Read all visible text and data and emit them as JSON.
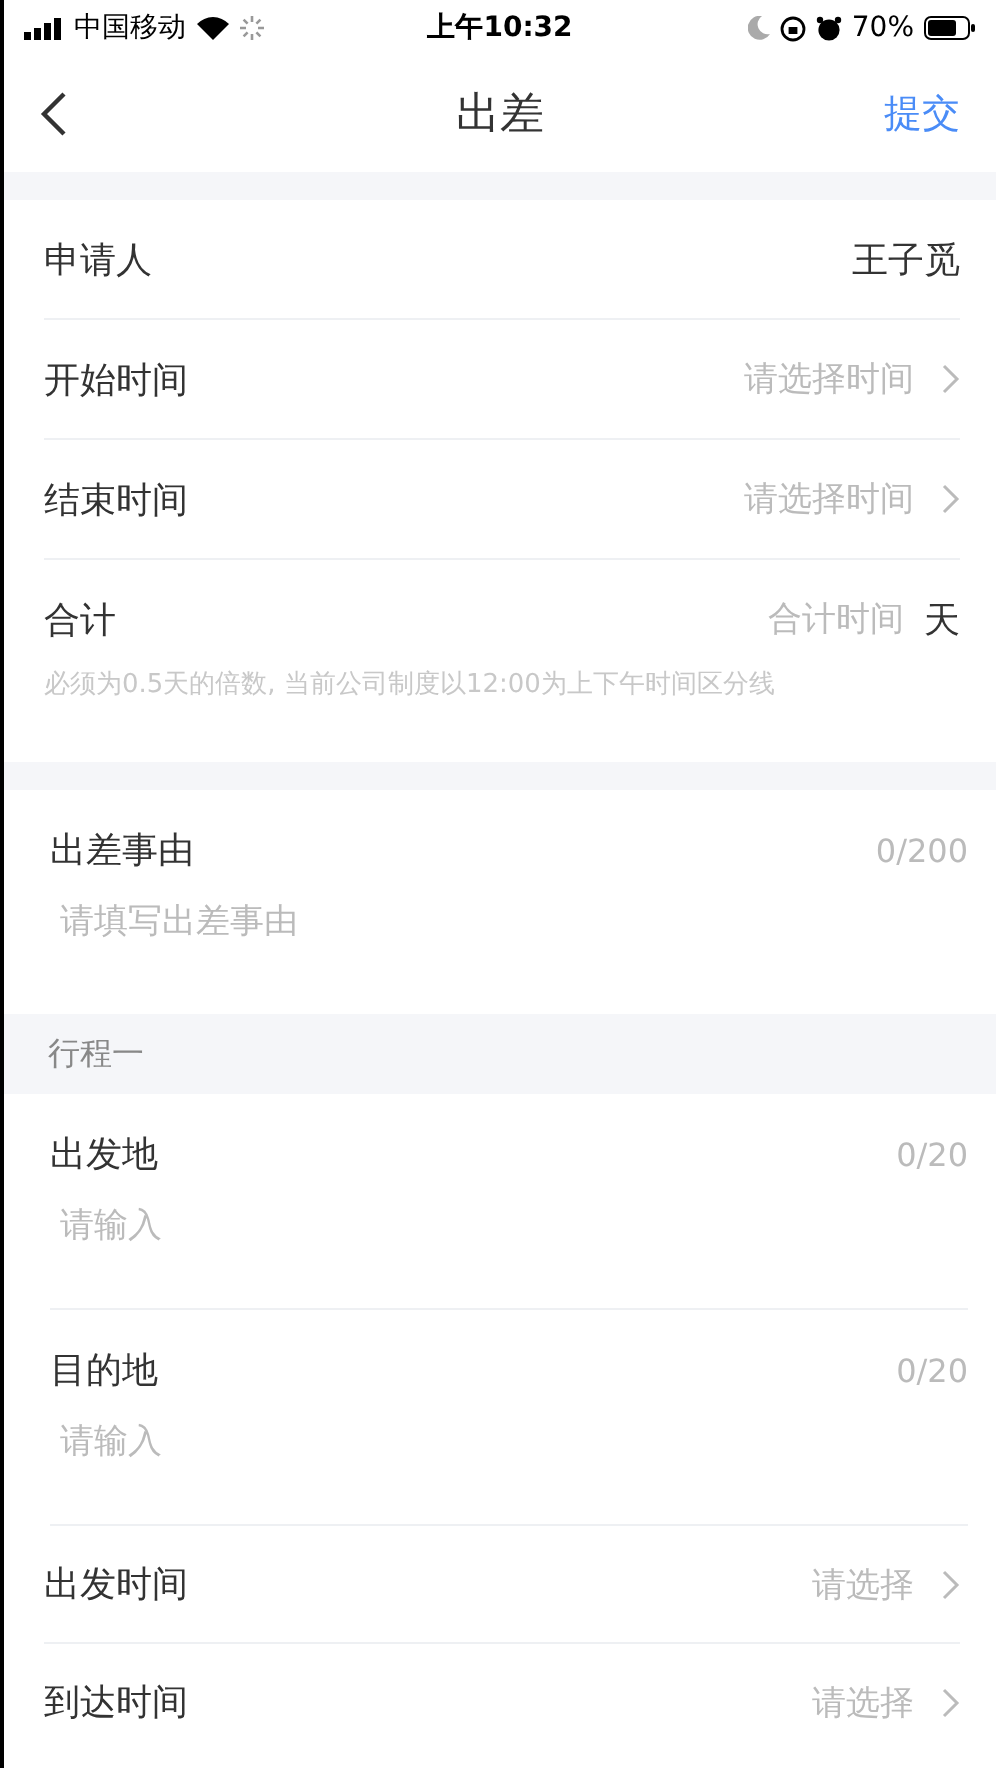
{
  "status_bar": {
    "carrier": "中国移动",
    "time": "上午10:32",
    "battery": "70%"
  },
  "nav": {
    "title": "出差",
    "action": "提交"
  },
  "basic_rows": [
    {
      "kind": "value",
      "label": "申请人",
      "value": "王子觅"
    },
    {
      "kind": "select",
      "label": "开始时间",
      "prompt": "请选择时间"
    },
    {
      "kind": "select",
      "label": "结束时间",
      "prompt": "请选择时间"
    },
    {
      "kind": "total",
      "label": "合计",
      "prompt": "合计时间",
      "unit": "天",
      "note": "必须为0.5天的倍数, 当前公司制度以12:00为上下午时间区分线"
    }
  ],
  "reason": {
    "label": "出差事由",
    "counter": "0/200",
    "placeholder": "请填写出差事由"
  },
  "itinerary": {
    "title": "行程一",
    "fields": [
      {
        "kind": "text",
        "label": "出发地",
        "counter": "0/20",
        "placeholder": "请输入"
      },
      {
        "kind": "text",
        "label": "目的地",
        "counter": "0/20",
        "placeholder": "请输入"
      },
      {
        "kind": "select",
        "label": "出发时间",
        "prompt": "请选择"
      },
      {
        "kind": "select",
        "label": "到达时间",
        "prompt": "请选择"
      }
    ]
  }
}
